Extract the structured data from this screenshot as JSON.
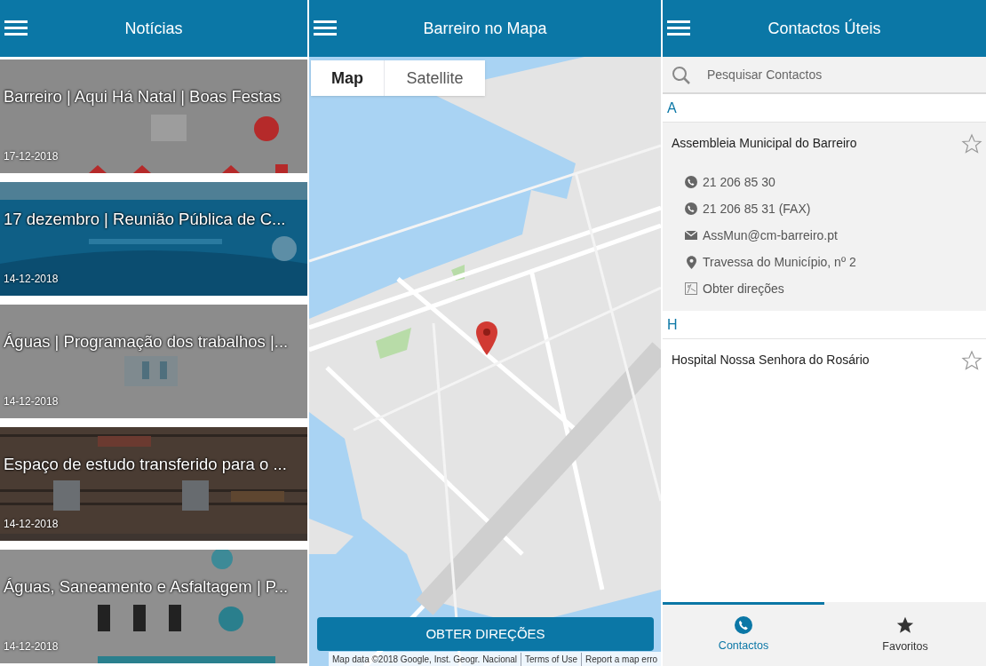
{
  "screens": [
    {
      "kind": "news",
      "title": "Notícias",
      "items": [
        {
          "title": "Barreiro | Aqui Há Natal | Boas Festas",
          "date": "17-12-2018"
        },
        {
          "title": "17 dezembro | Reunião Pública de C...",
          "date": "14-12-2018"
        },
        {
          "title": "Águas | Programação dos trabalhos |...",
          "date": "14-12-2018"
        },
        {
          "title": "Espaço de estudo transferido para o ...",
          "date": "14-12-2018"
        },
        {
          "title": "Águas, Saneamento e Asfaltagem | P...",
          "date": "14-12-2018"
        }
      ]
    },
    {
      "kind": "map",
      "title": "Barreiro no Mapa",
      "map_types": [
        {
          "label": "Map",
          "selected": true
        },
        {
          "label": "Satellite",
          "selected": false
        }
      ],
      "button": "OBTER DIREÇÕES",
      "attribution": [
        "Map data ©2018 Google, Inst. Geogr. Nacional",
        "Terms of Use",
        "Report a map erro"
      ]
    },
    {
      "kind": "contacts",
      "title": "Contactos Úteis",
      "search": {
        "placeholder": "Pesquisar Contactos"
      },
      "sections": [
        {
          "letter": "A",
          "contacts": [
            {
              "name": "Assembleia Municipal do Barreiro",
              "favorite": false,
              "expanded": true,
              "details": [
                {
                  "kind": "phone",
                  "text": "21 206 85 30"
                },
                {
                  "kind": "phone",
                  "text": "21 206 85 31 (FAX)"
                },
                {
                  "kind": "email",
                  "text": "AssMun@cm-barreiro.pt"
                },
                {
                  "kind": "address",
                  "text": "Travessa do Município, nº 2"
                },
                {
                  "kind": "directions",
                  "text": "Obter direções"
                }
              ]
            }
          ]
        },
        {
          "letter": "H",
          "contacts": [
            {
              "name": "Hospital Nossa Senhora do Rosário",
              "favorite": false,
              "expanded": false
            }
          ]
        }
      ],
      "tabs": [
        {
          "label": "Contactos",
          "selected": true
        },
        {
          "label": "Favoritos",
          "selected": false
        }
      ]
    }
  ]
}
